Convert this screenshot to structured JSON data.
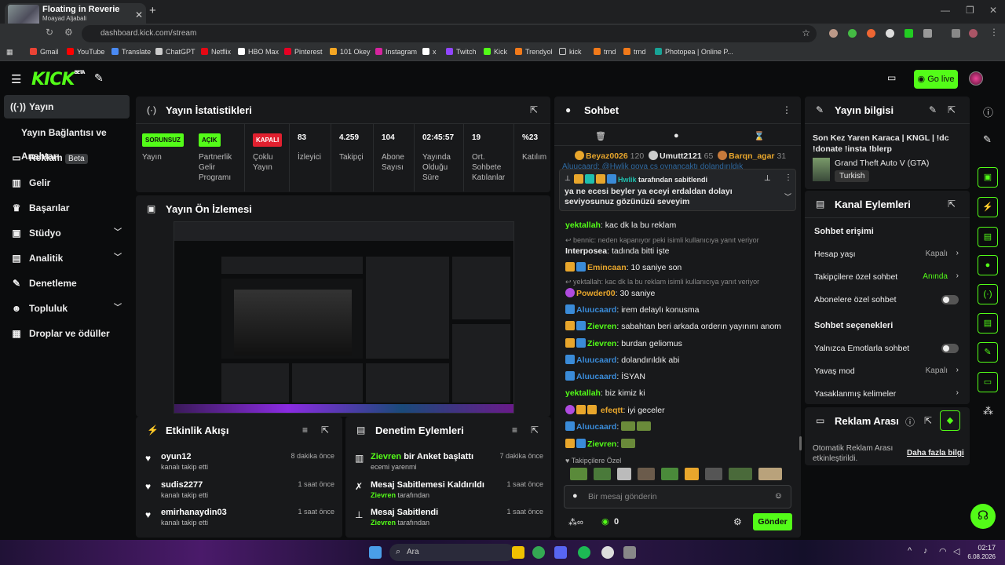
{
  "browser": {
    "tab_title": "Floating in Reverie",
    "tab_subtitle": "Moayad Aljabali",
    "url": "dashboard.kick.com/stream",
    "bookmarks": [
      "Gmail",
      "YouTube",
      "Translate",
      "ChatGPT",
      "Netflix",
      "HBO Max",
      "Pinterest",
      "101 Okey",
      "Instagram",
      "x",
      "Twitch",
      "Kick",
      "Trendyol",
      "kick",
      "trnd",
      "trnd",
      "Photopea | Online P..."
    ]
  },
  "header": {
    "logo": "KICK",
    "logo_sup": "BETA",
    "go_live": "Go live"
  },
  "sidebar": {
    "items": [
      {
        "label": "Yayın",
        "icon": "((·))"
      },
      {
        "label": "Yayın Bağlantısı ve Anahtarı",
        "icon": ""
      },
      {
        "label": "Reklam",
        "icon": "▭",
        "badge": "Beta"
      },
      {
        "label": "Gelir",
        "icon": "▥"
      },
      {
        "label": "Başarılar",
        "icon": "🏆"
      },
      {
        "label": "Stüdyo",
        "icon": "▣"
      },
      {
        "label": "Analitik",
        "icon": "▤"
      },
      {
        "label": "Denetleme",
        "icon": "🔧"
      },
      {
        "label": "Topluluk",
        "icon": "👥"
      },
      {
        "label": "Droplar ve ödüller",
        "icon": "🎁"
      }
    ]
  },
  "stats": {
    "title": "Yayın İstatistikleri",
    "items": [
      {
        "value": "SORUNSUZ",
        "label": "Yayın",
        "badge": true,
        "color": "#53fc18"
      },
      {
        "value": "AÇIK",
        "label": "Partnerlik Gelir Programı",
        "badge": true,
        "color": "#53fc18"
      },
      {
        "value": "KAPALI",
        "label": "Çoklu Yayın",
        "badge": true,
        "color": "#e1202f"
      },
      {
        "value": "83",
        "label": "İzleyici"
      },
      {
        "value": "4.259",
        "label": "Takipçi"
      },
      {
        "value": "104",
        "label": "Abone Sayısı"
      },
      {
        "value": "02:45:57",
        "label": "Yayında Olduğu Süre"
      },
      {
        "value": "19",
        "label": "Ort. Sohbete Katılanlar"
      },
      {
        "value": "%23",
        "label": "Katılım"
      }
    ]
  },
  "preview": {
    "title": "Yayın Ön İzlemesi"
  },
  "activity": {
    "title": "Etkinlik Akışı",
    "rows": [
      {
        "name": "oyun12",
        "sub": "kanalı takip etti",
        "time": "8 dakika önce"
      },
      {
        "name": "sudis2277",
        "sub": "kanalı takip etti",
        "time": "1 saat önce"
      },
      {
        "name": "emirhanaydin03",
        "sub": "kanalı takip etti",
        "time": "1 saat önce"
      }
    ]
  },
  "moderation": {
    "title": "Denetim Eylemleri",
    "rows": [
      {
        "user": "Zievren",
        "action": " bir Anket başlattı",
        "sub": "ecemi yarenmi",
        "time": "7 dakika önce"
      },
      {
        "user": "",
        "action": "Mesaj Sabitlemesi Kaldırıldı",
        "sub": "Zievren",
        "sub2": " tarafından",
        "time": "1 saat önce"
      },
      {
        "user": "",
        "action": "Mesaj Sabitlendi",
        "sub": "Zievren",
        "sub2": " tarafından",
        "time": "1 saat önce"
      }
    ]
  },
  "chat": {
    "title": "Sohbet",
    "top_users": [
      {
        "name": "Beyaz0026",
        "count": "120"
      },
      {
        "name": "Umutt2121",
        "count": "65"
      },
      {
        "name": "Barqn_agar",
        "count": "31"
      }
    ],
    "pinned_by": "Hwlik",
    "pinned_by_suffix": " tarafından sabitlendi",
    "pinned_text": "ya ne ecesi beyler ya eceyi erdaldan dolayı seviyosunuz gözünüzü seveyim",
    "behind_line": "Aluucaard: @Hwlik gova cs oynancaktı dolandırıldık",
    "messages": [
      {
        "user": "yektallah",
        "text": "kac dk la bu reklam",
        "color": "#53fc18"
      },
      {
        "reply": "bennic: neden kapanıyor peki isimli kullanıcıya yanıt veriyor"
      },
      {
        "user": "Interposea",
        "text": "tadında bitti işte",
        "color": "#ffffff"
      },
      {
        "user": "Emincaan",
        "text": "10 saniye son",
        "color": "#e8a62c"
      },
      {
        "reply": "yektallah: kac dk la bu reklam isimli kullanıcıya yanıt veriyor"
      },
      {
        "user": "Powder00",
        "text": "30 saniye",
        "color": "#e8a62c"
      },
      {
        "user": "Aluucaard",
        "text": "irem delaylı konusma",
        "color": "#3a8bd8"
      },
      {
        "user": "Zievren",
        "text": "sabahtan beri arkada orderın yayınını anom",
        "color": "#53fc18"
      },
      {
        "user": "Zievren",
        "text": "burdan geliomus",
        "color": "#53fc18"
      },
      {
        "user": "Aluucaard",
        "text": "dolandırıldık abi",
        "color": "#3a8bd8"
      },
      {
        "user": "Aluucaard",
        "text": "İSYAN",
        "color": "#3a8bd8"
      },
      {
        "user": "yektallah",
        "text": "biz kimiz ki",
        "color": "#53fc18"
      },
      {
        "user": "efeqtt",
        "text": "iyi geceler",
        "color": "#e8a62c"
      },
      {
        "user": "Aluucaard",
        "text": "",
        "color": "#3a8bd8"
      },
      {
        "user": "Zievren",
        "text": "",
        "color": "#53fc18"
      }
    ],
    "followers_only": "Takipçilere Özel",
    "input_placeholder": "Bir mesaj gönderin",
    "count": "0",
    "send": "Gönder"
  },
  "stream_info": {
    "title": "Yayın bilgisi",
    "stream_title": "Son Kez Yaren Karaca | KNGL | !dc !donate !insta !blerp",
    "game": "Grand Theft Auto V (GTA)",
    "language": "Turkish"
  },
  "channel_actions": {
    "title": "Kanal Eylemleri",
    "chat_access": "Sohbet erişimi",
    "account_age": "Hesap yaşı",
    "account_age_val": "Kapalı",
    "followers_chat": "Takipçilere özel sohbet",
    "followers_chat_val": "Anında",
    "subs_chat": "Abonelere özel sohbet",
    "chat_options": "Sohbet seçenekleri",
    "emote_only": "Yalnızca Emotlarla sohbet",
    "slow_mode": "Yavaş mod",
    "slow_mode_val": "Kapalı",
    "banned_words": "Yasaklanmış kelimeler"
  },
  "ad_break": {
    "title": "Reklam Arası",
    "text": "Otomatik Reklam Arası etkinleştirildi.",
    "link": "Daha fazla bilgi"
  },
  "taskbar": {
    "search": "Ara",
    "time": "02:17",
    "date": "6.08.2026"
  }
}
